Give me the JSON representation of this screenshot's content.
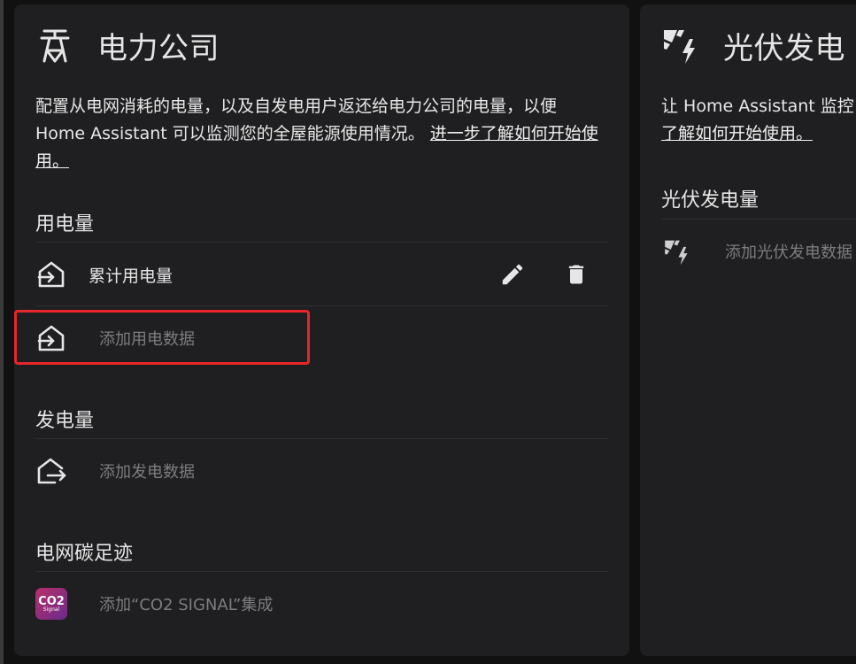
{
  "grid_card": {
    "title": "电力公司",
    "title_icon": "transmission-tower-icon",
    "description": "配置从电网消耗的电量，以及自发电用户返还给电力公司的电量，以便 Home Assistant 可以监测您的全屋能源使用情况。",
    "learn_more_link": "进一步了解如何开始使用。",
    "consumption": {
      "heading": "用电量",
      "items": [
        {
          "icon": "transmission-tower-import-icon",
          "label": "累计用电量"
        }
      ],
      "add_label": "添加用电数据"
    },
    "return": {
      "heading": "发电量",
      "add_icon": "transmission-tower-export-icon",
      "add_label": "添加发电数据"
    },
    "co2": {
      "heading": "电网碳足迹",
      "badge_main": "CO2",
      "badge_sub": "Signal",
      "add_label": "添加“CO2 SIGNAL”集成"
    }
  },
  "solar_card": {
    "title": "光伏发电",
    "title_icon": "solar-power-icon",
    "description": "让 Home Assistant 监控",
    "learn_more_link": "了解如何开始使用。",
    "production": {
      "heading": "光伏发电量",
      "add_label": "添加光伏发电数据"
    }
  },
  "colors": {
    "card_bg": "#1f1f21",
    "page_bg": "#111111",
    "highlight": "#e8262a",
    "text_primary": "#e6e6e6",
    "text_muted": "#7d7d80"
  }
}
